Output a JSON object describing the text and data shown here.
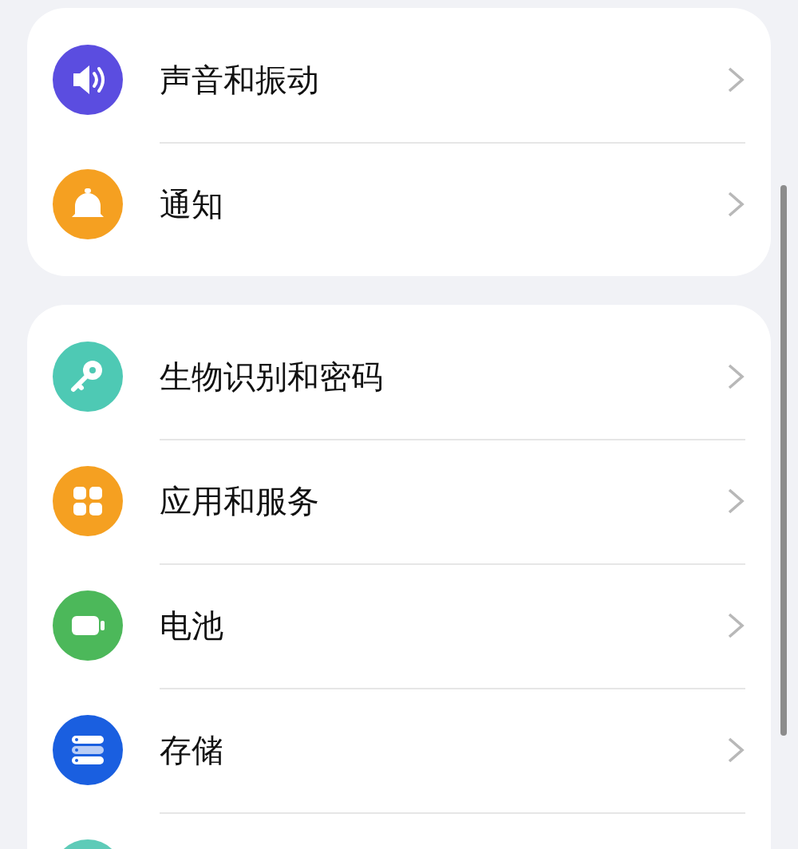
{
  "groups": [
    {
      "items": [
        {
          "label": "声音和振动",
          "kind": "speaker",
          "color": "#5b4de0"
        },
        {
          "label": "通知",
          "kind": "bell",
          "color": "#f5a021"
        }
      ]
    },
    {
      "items": [
        {
          "label": "生物识别和密码",
          "kind": "key",
          "color": "#4ec9b4"
        },
        {
          "label": "应用和服务",
          "kind": "grid",
          "color": "#f5a021"
        },
        {
          "label": "电池",
          "kind": "battery",
          "color": "#4cb85a"
        },
        {
          "label": "存储",
          "kind": "storage",
          "color": "#1a5fe0"
        },
        {
          "kind": "blank",
          "color": "#5ecbb8"
        }
      ]
    }
  ]
}
